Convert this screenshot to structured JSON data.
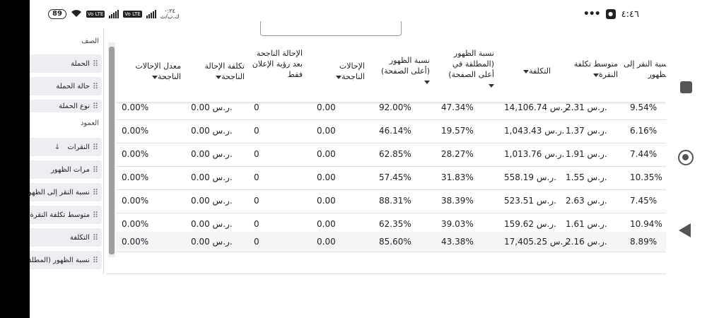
{
  "status_bar": {
    "battery": "89",
    "network_small_time": "٠:٢٤",
    "network_small_rate": "ك.ب/ث",
    "volte": "Vo LTE",
    "time": "٤:٤٦",
    "more": "•••"
  },
  "sidebar": {
    "rows_header": "الصف",
    "row_items": [
      "الحملة",
      "حالة الحملة",
      "نوع الحملة"
    ],
    "columns_header": "العمود",
    "column_items": [
      "النقرات",
      "مرات الظهور",
      "نسبة النقر إلى الظهور",
      "متوسط تكلفة النقرة",
      "التكلفة",
      "نسبة الظهور (المطلقة"
    ],
    "sort_arrow": "↓"
  },
  "table": {
    "headers": [
      "نسبة النقر إلى الظهور",
      "متوسط تكلفة النقرة",
      "التكلفة",
      "نسبة الظهور (المطلقة في أعلى الصفحة)",
      "نسبة الظهور (أعلى الصفحة)",
      "الإحالات الناجحة",
      "الإحالة الناجحة بعد رؤية الإعلان فقط",
      "تكلفة الإحالة الناجحة",
      "معدل الإحالات الناجحة"
    ],
    "rows": [
      [
        "9.54%",
        "2.31 ر.س.",
        "14,106.74 ر.س.",
        "47.34%",
        "92.00%",
        "0.00",
        "0",
        "0.00 ر.س.",
        "0.00%"
      ],
      [
        "6.16%",
        "1.37 ر.س.",
        "1,043.43 ر.س.",
        "19.57%",
        "46.14%",
        "0.00",
        "0",
        "0.00 ر.س.",
        "0.00%"
      ],
      [
        "7.44%",
        "1.91 ر.س.",
        "1,013.76 ر.س.",
        "28.27%",
        "62.85%",
        "0.00",
        "0",
        "0.00 ر.س.",
        "0.00%"
      ],
      [
        "10.35%",
        "1.55 ر.س.",
        "558.19 ر.س.",
        "31.83%",
        "57.45%",
        "0.00",
        "0",
        "0.00 ر.س.",
        "0.00%"
      ],
      [
        "7.45%",
        "2.63 ر.س.",
        "523.51 ر.س.",
        "38.39%",
        "88.31%",
        "0.00",
        "0",
        "0.00 ر.س.",
        "0.00%"
      ],
      [
        "10.94%",
        "1.61 ر.س.",
        "159.62 ر.س.",
        "39.03%",
        "62.35%",
        "0.00",
        "0",
        "0.00 ر.س.",
        "0.00%"
      ]
    ],
    "total_row": [
      "8.89%",
      "2.16 ر.س.",
      "17,405.25 ر.س.",
      "43.38%",
      "85.60%",
      "0.00",
      "0",
      "0.00 ر.س.",
      "0.00%"
    ]
  }
}
